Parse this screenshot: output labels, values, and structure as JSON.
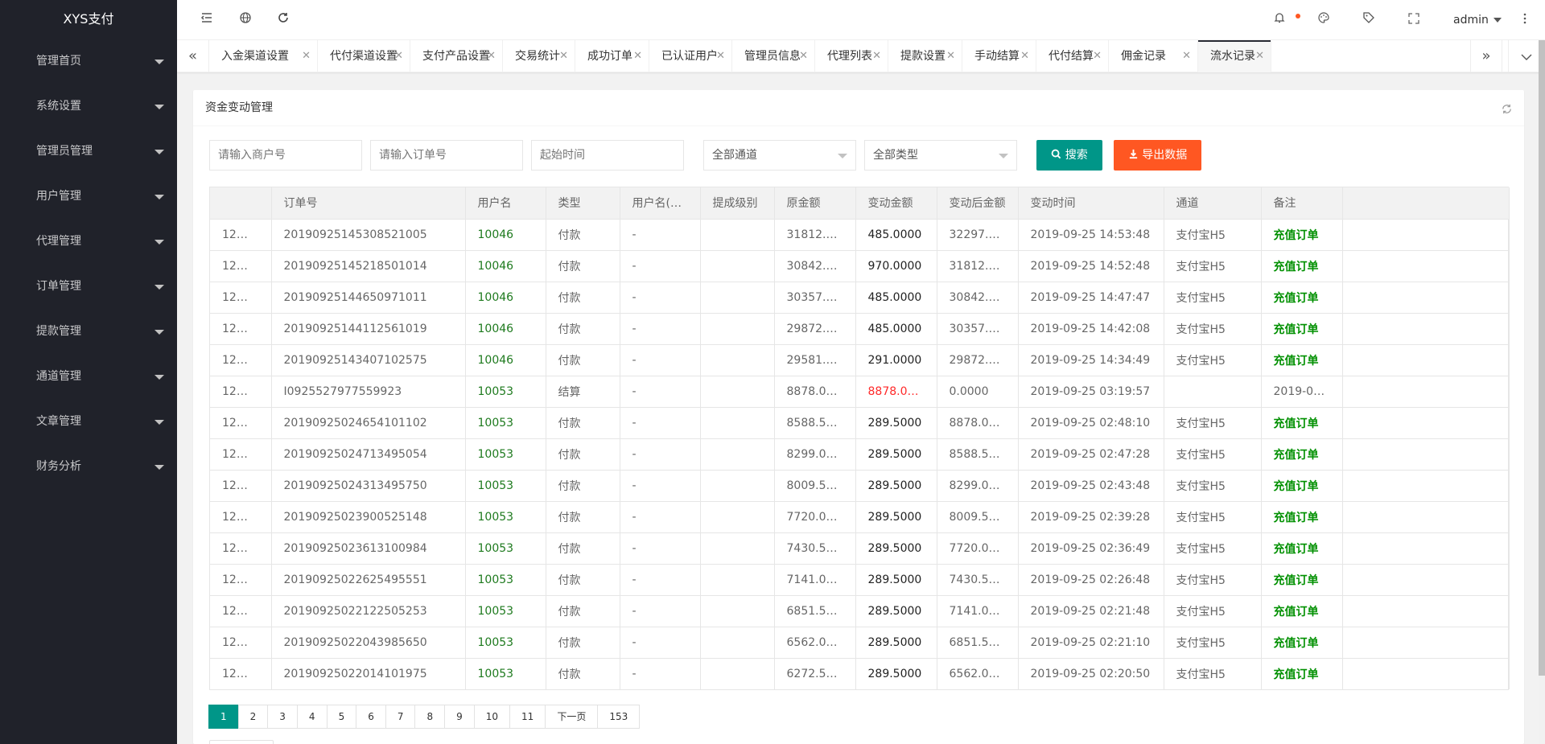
{
  "app": {
    "logo": "XYS支付"
  },
  "sidebar": {
    "items": [
      {
        "label": "管理首页"
      },
      {
        "label": "系统设置"
      },
      {
        "label": "管理员管理"
      },
      {
        "label": "用户管理"
      },
      {
        "label": "代理管理"
      },
      {
        "label": "订单管理"
      },
      {
        "label": "提款管理"
      },
      {
        "label": "通道管理"
      },
      {
        "label": "文章管理"
      },
      {
        "label": "财务分析"
      }
    ]
  },
  "header": {
    "user": "admin",
    "icons": [
      "collapse-menu-icon",
      "globe-icon",
      "refresh-icon",
      "bell-icon",
      "theme-icon",
      "tag-icon",
      "fullscreen-icon",
      "more-vertical-icon"
    ],
    "notice_color": "#ff5722"
  },
  "tabs": [
    {
      "label": "入金渠道设置"
    },
    {
      "label": "代付渠道设置"
    },
    {
      "label": "支付产品设置"
    },
    {
      "label": "交易统计"
    },
    {
      "label": "成功订单"
    },
    {
      "label": "已认证用户"
    },
    {
      "label": "管理员信息"
    },
    {
      "label": "代理列表"
    },
    {
      "label": "提款设置"
    },
    {
      "label": "手动结算"
    },
    {
      "label": "代付结算"
    },
    {
      "label": "佣金记录"
    },
    {
      "label": "流水记录",
      "active": true
    }
  ],
  "panel": {
    "title": "资金变动管理"
  },
  "filters": {
    "merchant_placeholder": "请输入商户号",
    "order_placeholder": "请输入订单号",
    "start_placeholder": "起始时间",
    "channel_select": "全部通道",
    "type_select": "全部类型",
    "search_label": "搜索",
    "export_label": "导出数据",
    "search_color": "#009688",
    "export_color": "#ff5722"
  },
  "table": {
    "headers": [
      "",
      "订单号",
      "用户名",
      "类型",
      "用户名(…",
      "提成级别",
      "原金额",
      "变动金额",
      "变动后金额",
      "变动时间",
      "通道",
      "备注"
    ],
    "rows": [
      [
        "12…",
        "20190925145308521005",
        "10046",
        "付款",
        "-",
        "",
        "31812.0…",
        "485.0000",
        "32297.0…",
        "2019-09-25 14:53:48",
        "支付宝H5",
        "充值订单"
      ],
      [
        "12…",
        "20190925145218501014",
        "10046",
        "付款",
        "-",
        "",
        "30842.0…",
        "970.0000",
        "31812.0…",
        "2019-09-25 14:52:48",
        "支付宝H5",
        "充值订单"
      ],
      [
        "12…",
        "20190925144650971011",
        "10046",
        "付款",
        "-",
        "",
        "30357.0…",
        "485.0000",
        "30842.0…",
        "2019-09-25 14:47:47",
        "支付宝H5",
        "充值订单"
      ],
      [
        "12…",
        "20190925144112561019",
        "10046",
        "付款",
        "-",
        "",
        "29872.0…",
        "485.0000",
        "30357.0…",
        "2019-09-25 14:42:08",
        "支付宝H5",
        "充值订单"
      ],
      [
        "12…",
        "20190925143407102575",
        "10046",
        "付款",
        "-",
        "",
        "29581.0…",
        "291.0000",
        "29872.0…",
        "2019-09-25 14:34:49",
        "支付宝H5",
        "充值订单"
      ],
      [
        "12…",
        "I0925527977559923",
        "10053",
        "结算",
        "-",
        "",
        "8878.0000",
        "8878.0000",
        "0.0000",
        "2019-09-25 03:19:57",
        "",
        "2019-09…"
      ],
      [
        "12…",
        "20190925024654101102",
        "10053",
        "付款",
        "-",
        "",
        "8588.5000",
        "289.5000",
        "8878.0000",
        "2019-09-25 02:48:10",
        "支付宝H5",
        "充值订单"
      ],
      [
        "12…",
        "20190925024713495054",
        "10053",
        "付款",
        "-",
        "",
        "8299.0000",
        "289.5000",
        "8588.5000",
        "2019-09-25 02:47:28",
        "支付宝H5",
        "充值订单"
      ],
      [
        "12…",
        "20190925024313495750",
        "10053",
        "付款",
        "-",
        "",
        "8009.5000",
        "289.5000",
        "8299.0000",
        "2019-09-25 02:43:48",
        "支付宝H5",
        "充值订单"
      ],
      [
        "12…",
        "20190925023900525148",
        "10053",
        "付款",
        "-",
        "",
        "7720.0000",
        "289.5000",
        "8009.5000",
        "2019-09-25 02:39:28",
        "支付宝H5",
        "充值订单"
      ],
      [
        "12…",
        "20190925023613100984",
        "10053",
        "付款",
        "-",
        "",
        "7430.5000",
        "289.5000",
        "7720.0000",
        "2019-09-25 02:36:49",
        "支付宝H5",
        "充值订单"
      ],
      [
        "12…",
        "20190925022625495551",
        "10053",
        "付款",
        "-",
        "",
        "7141.0000",
        "289.5000",
        "7430.5000",
        "2019-09-25 02:26:48",
        "支付宝H5",
        "充值订单"
      ],
      [
        "12…",
        "20190925022122505253",
        "10053",
        "付款",
        "-",
        "",
        "6851.5000",
        "289.5000",
        "7141.0000",
        "2019-09-25 02:21:48",
        "支付宝H5",
        "充值订单"
      ],
      [
        "12…",
        "20190925022043985650",
        "10053",
        "付款",
        "-",
        "",
        "6562.0000",
        "289.5000",
        "6851.5000",
        "2019-09-25 02:21:10",
        "支付宝H5",
        "充值订单"
      ],
      [
        "12…",
        "20190925022014101975",
        "10053",
        "付款",
        "-",
        "",
        "6272.5000",
        "289.5000",
        "6562.0000",
        "2019-09-25 02:20:50",
        "支付宝H5",
        "充值订单"
      ]
    ],
    "highlight_red_row": 5
  },
  "pagination": {
    "pages": [
      "1",
      "2",
      "3",
      "4",
      "5",
      "6",
      "7",
      "8",
      "9",
      "10",
      "11"
    ],
    "next_label": "下一页",
    "last": "153",
    "current": "1"
  }
}
